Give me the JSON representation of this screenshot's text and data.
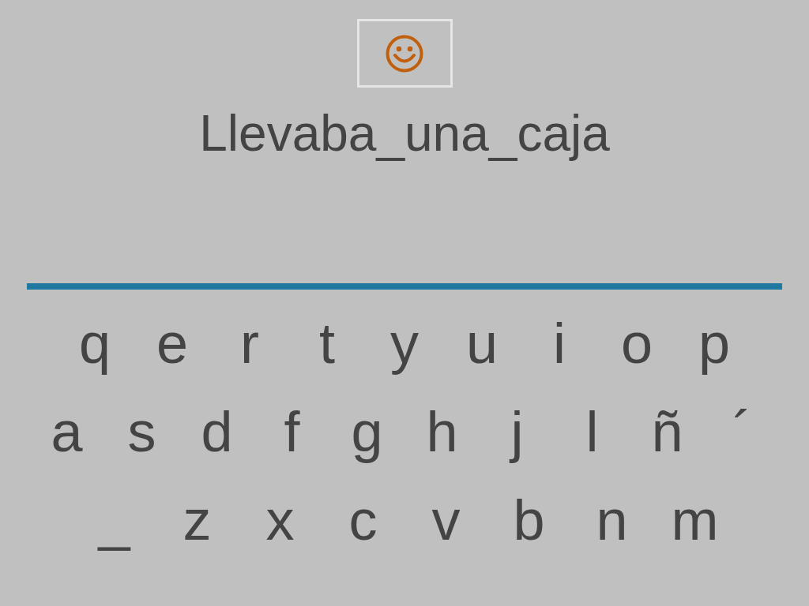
{
  "phrase": "Llevaba_una_caja",
  "keyboard_rows": [
    [
      "q",
      "e",
      "r",
      "t",
      "y",
      "u",
      "i",
      "o",
      "p"
    ],
    [
      "a",
      "s",
      "d",
      "f",
      "g",
      "h",
      "j",
      "l",
      "ñ",
      "´"
    ],
    [
      "_",
      "z",
      "x",
      "c",
      "v",
      "b",
      "n",
      "m"
    ]
  ]
}
